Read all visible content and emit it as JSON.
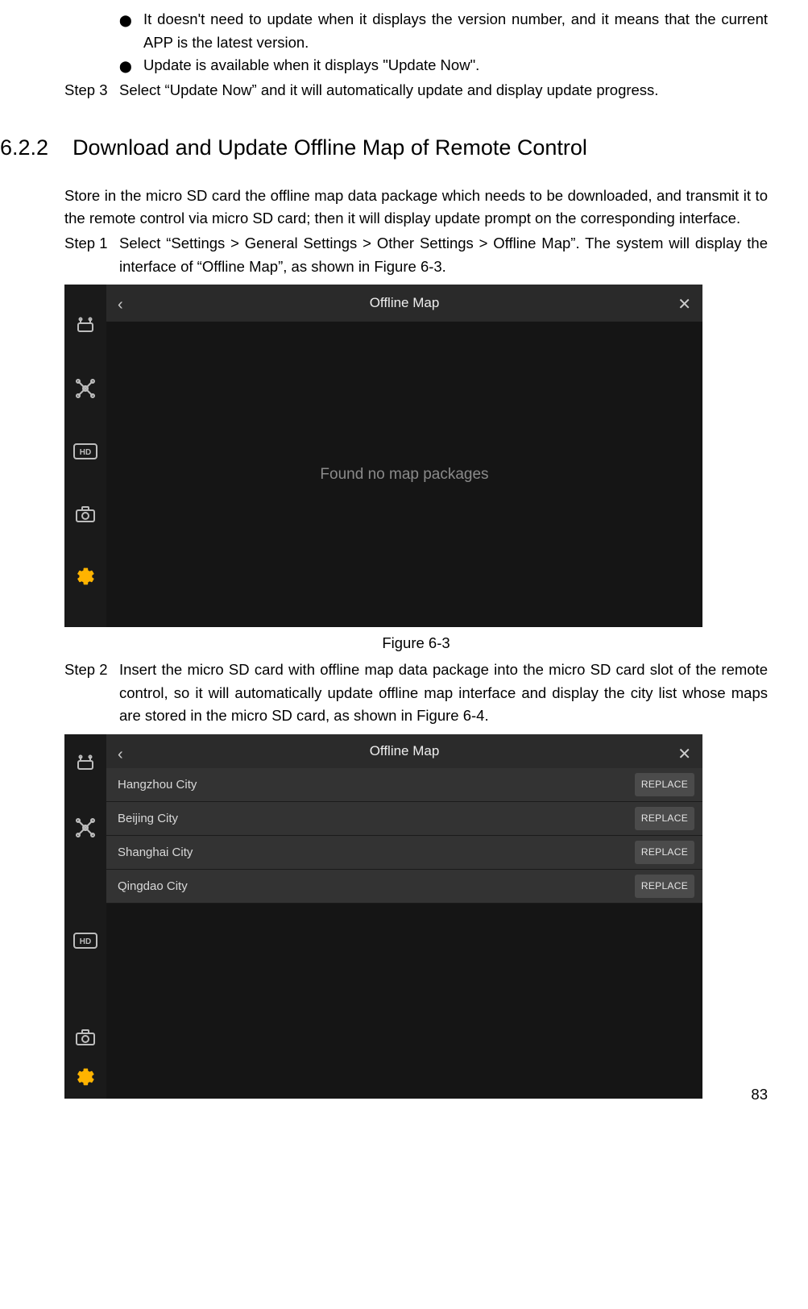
{
  "page_number": "83",
  "bullets": [
    "It doesn't need to update when it displays the version number, and it means that the current APP is the latest version.",
    "Update is available when it displays \"Update Now\"."
  ],
  "step3_label": "Step 3",
  "step3_text": "Select “Update Now” and it will automatically update and display update progress.",
  "section_number": "6.2.2",
  "section_title": "Download and Update Offline Map of Remote Control",
  "intro": "Store in the micro SD card the offline map data package which needs to be downloaded, and transmit it to the remote control via micro SD card; then it will display update prompt on the corresponding interface.",
  "step1_label": "Step 1",
  "step1_text": "Select “Settings > General Settings > Other Settings > Offline Map”. The system will display the interface of “Offline Map”, as shown in Figure 6-3.",
  "figure1_caption": "Figure 6-3",
  "step2_label": "Step 2",
  "step2_text": "Insert the micro SD card with offline map data package into the micro SD card slot of the remote control, so it will automatically update offline map interface and display the city list whose maps are stored in the micro SD card, as shown in Figure 6-4.",
  "ui1": {
    "title": "Offline Map",
    "empty_text": "Found no map packages"
  },
  "ui2": {
    "title": "Offline Map",
    "rows": [
      {
        "name": "Hangzhou City",
        "action": "REPLACE"
      },
      {
        "name": "Beijing City",
        "action": "REPLACE"
      },
      {
        "name": "Shanghai City",
        "action": "REPLACE"
      },
      {
        "name": "Qingdao City",
        "action": "REPLACE"
      }
    ]
  }
}
